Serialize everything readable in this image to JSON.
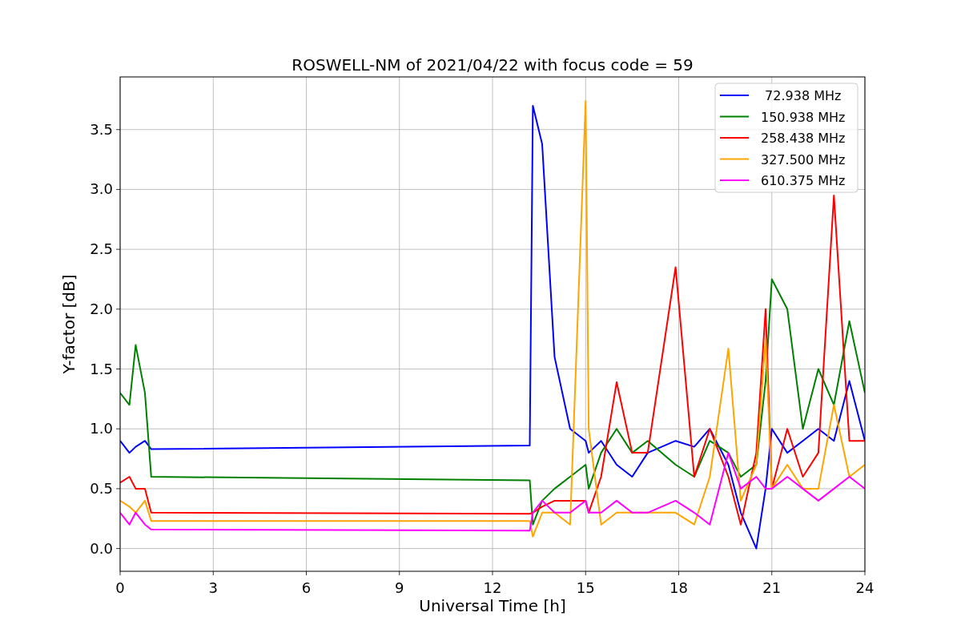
{
  "chart_data": {
    "type": "line",
    "title": "ROSWELL-NM of 2021/04/22 with focus code = 59",
    "xlabel": "Universal Time [h]",
    "ylabel": "Y-factor [dB]",
    "x": [
      0,
      0.3,
      0.5,
      0.8,
      1,
      13.2,
      13.3,
      13.6,
      14,
      14.5,
      15,
      15.1,
      15.5,
      16,
      16.5,
      17,
      17.9,
      18.5,
      19,
      19.6,
      20,
      20.5,
      20.8,
      21,
      21.5,
      22,
      22.5,
      23,
      23.5,
      24
    ],
    "series": [
      {
        "name": " 72.938 MHz",
        "color": "#0000ff",
        "values": [
          0.9,
          0.8,
          0.85,
          0.9,
          0.83,
          0.86,
          3.7,
          3.38,
          1.6,
          1.0,
          0.9,
          0.8,
          0.9,
          0.7,
          0.6,
          0.8,
          0.9,
          0.85,
          1.0,
          0.7,
          0.3,
          0.0,
          0.5,
          1.0,
          0.8,
          0.9,
          1.0,
          0.9,
          1.4,
          0.9
        ]
      },
      {
        "name": "150.938 MHz",
        "color": "#008000",
        "values": [
          1.3,
          1.2,
          1.7,
          1.3,
          0.6,
          0.57,
          0.2,
          0.4,
          0.5,
          0.6,
          0.7,
          0.5,
          0.8,
          1.0,
          0.8,
          0.9,
          0.7,
          0.6,
          0.9,
          0.8,
          0.6,
          0.7,
          1.4,
          2.25,
          2.0,
          1.0,
          1.5,
          1.2,
          1.9,
          1.3
        ]
      },
      {
        "name": "258.438 MHz",
        "color": "#ff0000",
        "values": [
          0.55,
          0.6,
          0.5,
          0.5,
          0.3,
          0.29,
          0.3,
          0.35,
          0.4,
          0.4,
          0.4,
          0.3,
          0.6,
          1.39,
          0.8,
          0.8,
          2.35,
          0.6,
          1.0,
          0.6,
          0.2,
          0.8,
          2.0,
          0.5,
          1.0,
          0.6,
          0.8,
          2.95,
          0.9,
          0.9
        ]
      },
      {
        "name": "327.500 MHz",
        "color": "#ffa500",
        "values": [
          0.4,
          0.35,
          0.3,
          0.4,
          0.23,
          0.23,
          0.1,
          0.3,
          0.3,
          0.2,
          3.74,
          1.0,
          0.2,
          0.3,
          0.3,
          0.3,
          0.3,
          0.2,
          0.6,
          1.67,
          0.4,
          0.7,
          1.75,
          0.5,
          0.7,
          0.5,
          0.5,
          1.2,
          0.6,
          0.7
        ]
      },
      {
        "name": "610.375 MHz",
        "color": "#ff00ff",
        "values": [
          0.3,
          0.2,
          0.3,
          0.2,
          0.16,
          0.15,
          0.3,
          0.4,
          0.3,
          0.3,
          0.4,
          0.3,
          0.3,
          0.4,
          0.3,
          0.3,
          0.4,
          0.3,
          0.2,
          0.8,
          0.5,
          0.6,
          0.5,
          0.5,
          0.6,
          0.5,
          0.4,
          0.5,
          0.6,
          0.5
        ]
      }
    ],
    "grid": true,
    "legend": "upper right",
    "xlim": [
      0,
      24
    ],
    "ylim": [
      -0.19,
      3.94
    ],
    "xticks": [
      0,
      3,
      6,
      9,
      12,
      15,
      18,
      21,
      24
    ],
    "yticks": [
      {
        "value": 0,
        "label": "0.0"
      },
      {
        "value": 0.5,
        "label": "0.5"
      },
      {
        "value": 1,
        "label": "1.0"
      },
      {
        "value": 1.5,
        "label": "1.5"
      },
      {
        "value": 2,
        "label": "2.0"
      },
      {
        "value": 2.5,
        "label": "2.5"
      },
      {
        "value": 3,
        "label": "3.0"
      },
      {
        "value": 3.5,
        "label": "3.5"
      }
    ]
  }
}
